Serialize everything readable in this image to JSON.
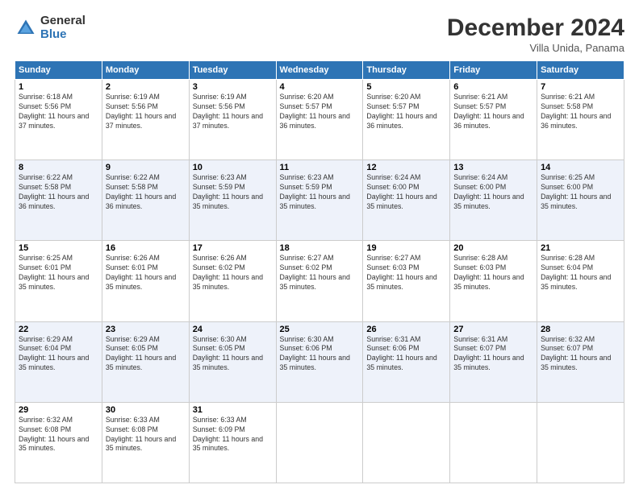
{
  "logo": {
    "general": "General",
    "blue": "Blue"
  },
  "header": {
    "month": "December 2024",
    "location": "Villa Unida, Panama"
  },
  "days_of_week": [
    "Sunday",
    "Monday",
    "Tuesday",
    "Wednesday",
    "Thursday",
    "Friday",
    "Saturday"
  ],
  "weeks": [
    [
      {
        "day": 1,
        "sunrise": "6:18 AM",
        "sunset": "5:56 PM",
        "daylight": "11 hours and 37 minutes."
      },
      {
        "day": 2,
        "sunrise": "6:19 AM",
        "sunset": "5:56 PM",
        "daylight": "11 hours and 37 minutes."
      },
      {
        "day": 3,
        "sunrise": "6:19 AM",
        "sunset": "5:56 PM",
        "daylight": "11 hours and 37 minutes."
      },
      {
        "day": 4,
        "sunrise": "6:20 AM",
        "sunset": "5:57 PM",
        "daylight": "11 hours and 36 minutes."
      },
      {
        "day": 5,
        "sunrise": "6:20 AM",
        "sunset": "5:57 PM",
        "daylight": "11 hours and 36 minutes."
      },
      {
        "day": 6,
        "sunrise": "6:21 AM",
        "sunset": "5:57 PM",
        "daylight": "11 hours and 36 minutes."
      },
      {
        "day": 7,
        "sunrise": "6:21 AM",
        "sunset": "5:58 PM",
        "daylight": "11 hours and 36 minutes."
      }
    ],
    [
      {
        "day": 8,
        "sunrise": "6:22 AM",
        "sunset": "5:58 PM",
        "daylight": "11 hours and 36 minutes."
      },
      {
        "day": 9,
        "sunrise": "6:22 AM",
        "sunset": "5:58 PM",
        "daylight": "11 hours and 36 minutes."
      },
      {
        "day": 10,
        "sunrise": "6:23 AM",
        "sunset": "5:59 PM",
        "daylight": "11 hours and 35 minutes."
      },
      {
        "day": 11,
        "sunrise": "6:23 AM",
        "sunset": "5:59 PM",
        "daylight": "11 hours and 35 minutes."
      },
      {
        "day": 12,
        "sunrise": "6:24 AM",
        "sunset": "6:00 PM",
        "daylight": "11 hours and 35 minutes."
      },
      {
        "day": 13,
        "sunrise": "6:24 AM",
        "sunset": "6:00 PM",
        "daylight": "11 hours and 35 minutes."
      },
      {
        "day": 14,
        "sunrise": "6:25 AM",
        "sunset": "6:00 PM",
        "daylight": "11 hours and 35 minutes."
      }
    ],
    [
      {
        "day": 15,
        "sunrise": "6:25 AM",
        "sunset": "6:01 PM",
        "daylight": "11 hours and 35 minutes."
      },
      {
        "day": 16,
        "sunrise": "6:26 AM",
        "sunset": "6:01 PM",
        "daylight": "11 hours and 35 minutes."
      },
      {
        "day": 17,
        "sunrise": "6:26 AM",
        "sunset": "6:02 PM",
        "daylight": "11 hours and 35 minutes."
      },
      {
        "day": 18,
        "sunrise": "6:27 AM",
        "sunset": "6:02 PM",
        "daylight": "11 hours and 35 minutes."
      },
      {
        "day": 19,
        "sunrise": "6:27 AM",
        "sunset": "6:03 PM",
        "daylight": "11 hours and 35 minutes."
      },
      {
        "day": 20,
        "sunrise": "6:28 AM",
        "sunset": "6:03 PM",
        "daylight": "11 hours and 35 minutes."
      },
      {
        "day": 21,
        "sunrise": "6:28 AM",
        "sunset": "6:04 PM",
        "daylight": "11 hours and 35 minutes."
      }
    ],
    [
      {
        "day": 22,
        "sunrise": "6:29 AM",
        "sunset": "6:04 PM",
        "daylight": "11 hours and 35 minutes."
      },
      {
        "day": 23,
        "sunrise": "6:29 AM",
        "sunset": "6:05 PM",
        "daylight": "11 hours and 35 minutes."
      },
      {
        "day": 24,
        "sunrise": "6:30 AM",
        "sunset": "6:05 PM",
        "daylight": "11 hours and 35 minutes."
      },
      {
        "day": 25,
        "sunrise": "6:30 AM",
        "sunset": "6:06 PM",
        "daylight": "11 hours and 35 minutes."
      },
      {
        "day": 26,
        "sunrise": "6:31 AM",
        "sunset": "6:06 PM",
        "daylight": "11 hours and 35 minutes."
      },
      {
        "day": 27,
        "sunrise": "6:31 AM",
        "sunset": "6:07 PM",
        "daylight": "11 hours and 35 minutes."
      },
      {
        "day": 28,
        "sunrise": "6:32 AM",
        "sunset": "6:07 PM",
        "daylight": "11 hours and 35 minutes."
      }
    ],
    [
      {
        "day": 29,
        "sunrise": "6:32 AM",
        "sunset": "6:08 PM",
        "daylight": "11 hours and 35 minutes."
      },
      {
        "day": 30,
        "sunrise": "6:33 AM",
        "sunset": "6:08 PM",
        "daylight": "11 hours and 35 minutes."
      },
      {
        "day": 31,
        "sunrise": "6:33 AM",
        "sunset": "6:09 PM",
        "daylight": "11 hours and 35 minutes."
      },
      null,
      null,
      null,
      null
    ]
  ]
}
